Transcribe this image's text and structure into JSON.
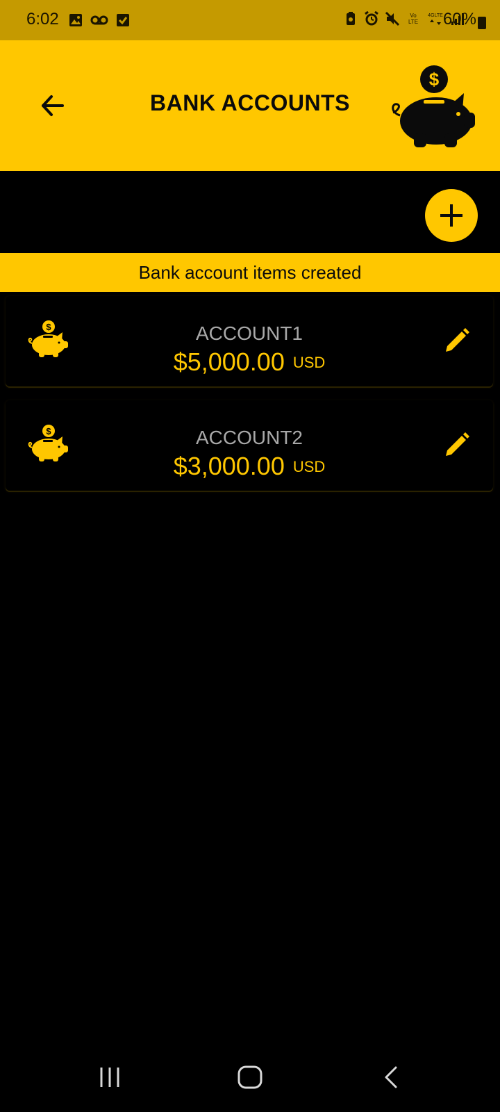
{
  "status_bar": {
    "time": "6:02",
    "battery": "60%",
    "left_icons": [
      "image-icon",
      "voicemail-icon",
      "checkbox-icon"
    ],
    "right_icons": [
      "battery-saver-icon",
      "alarm-icon",
      "mute-icon",
      "volte-icon",
      "lte-icon",
      "signal-icon"
    ]
  },
  "app_bar": {
    "title": "BANK ACCOUNTS"
  },
  "banner": {
    "text": "Bank account items created"
  },
  "accounts": [
    {
      "name": "ACCOUNT1",
      "amount": "$5,000.00",
      "currency": "USD"
    },
    {
      "name": "ACCOUNT2",
      "amount": "$3,000.00",
      "currency": "USD"
    }
  ],
  "colors": {
    "accent": "#ffc700",
    "status_bar": "#c59a00",
    "background": "#000000",
    "account_name": "#a8a8a8"
  },
  "nav_bar": {
    "icons": [
      "recent-apps-icon",
      "home-icon",
      "back-icon"
    ]
  }
}
